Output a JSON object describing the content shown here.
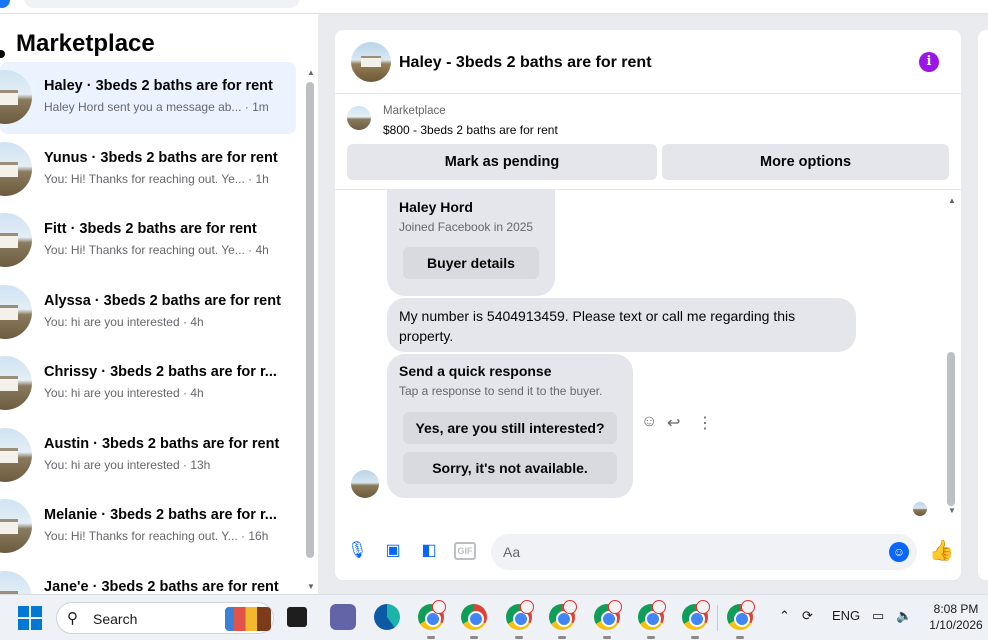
{
  "sidebar": {
    "title": "Marketplace",
    "conversations": [
      {
        "name": "Haley · 3beds 2 baths are for rent",
        "snippet": "Haley Hord sent you a message ab... · 1m"
      },
      {
        "name": "Yunus · 3beds 2 baths are for rent",
        "snippet": "You: Hi! Thanks for reaching out. Ye... · 1h"
      },
      {
        "name": "Fitt · 3beds 2 baths are for rent",
        "snippet": "You: Hi! Thanks for reaching out. Ye... · 4h"
      },
      {
        "name": "Alyssa · 3beds 2 baths are for rent",
        "snippet": "You: hi are you interested · 4h"
      },
      {
        "name": "Chrissy · 3beds 2 baths are for r...",
        "snippet": "You: hi are you interested · 4h"
      },
      {
        "name": "Austin · 3beds 2 baths are for rent",
        "snippet": "You: hi are you interested · 13h"
      },
      {
        "name": "Melanie · 3beds 2 baths are for r...",
        "snippet": "You: Hi! Thanks for reaching out. Y... · 16h"
      },
      {
        "name": "Jane'e · 3beds 2 baths are for rent",
        "snippet": ""
      }
    ]
  },
  "chat": {
    "header_title": "Haley - 3beds 2 baths are for rent",
    "info_icon": "info-icon",
    "listing": {
      "source": "Marketplace",
      "price_title": "$800 - 3beds 2 baths are for rent",
      "pending_label": "Mark as pending",
      "more_label": "More options"
    },
    "buyer_card": {
      "name": "Haley Hord",
      "joined": "Joined Facebook in 2025",
      "button_label": "Buyer details"
    },
    "message_text": "My number is 5404913459. Please text or call me regarding this property.",
    "quick_response": {
      "title": "Send a quick response",
      "subtitle": "Tap a response to send it to the buyer.",
      "option1": "Yes, are you still interested?",
      "option2": "Sorry, it's not available."
    },
    "composer": {
      "placeholder": "Aa",
      "gif_label": "GIF"
    }
  },
  "taskbar": {
    "search_label": "Search",
    "language": "ENG",
    "time": "8:08 PM",
    "date": "1/10/2026"
  },
  "colors": {
    "accent_blue": "#0866ff",
    "info_purple": "#9b14e8",
    "active_conversation_bg": "#eaf3ff"
  }
}
